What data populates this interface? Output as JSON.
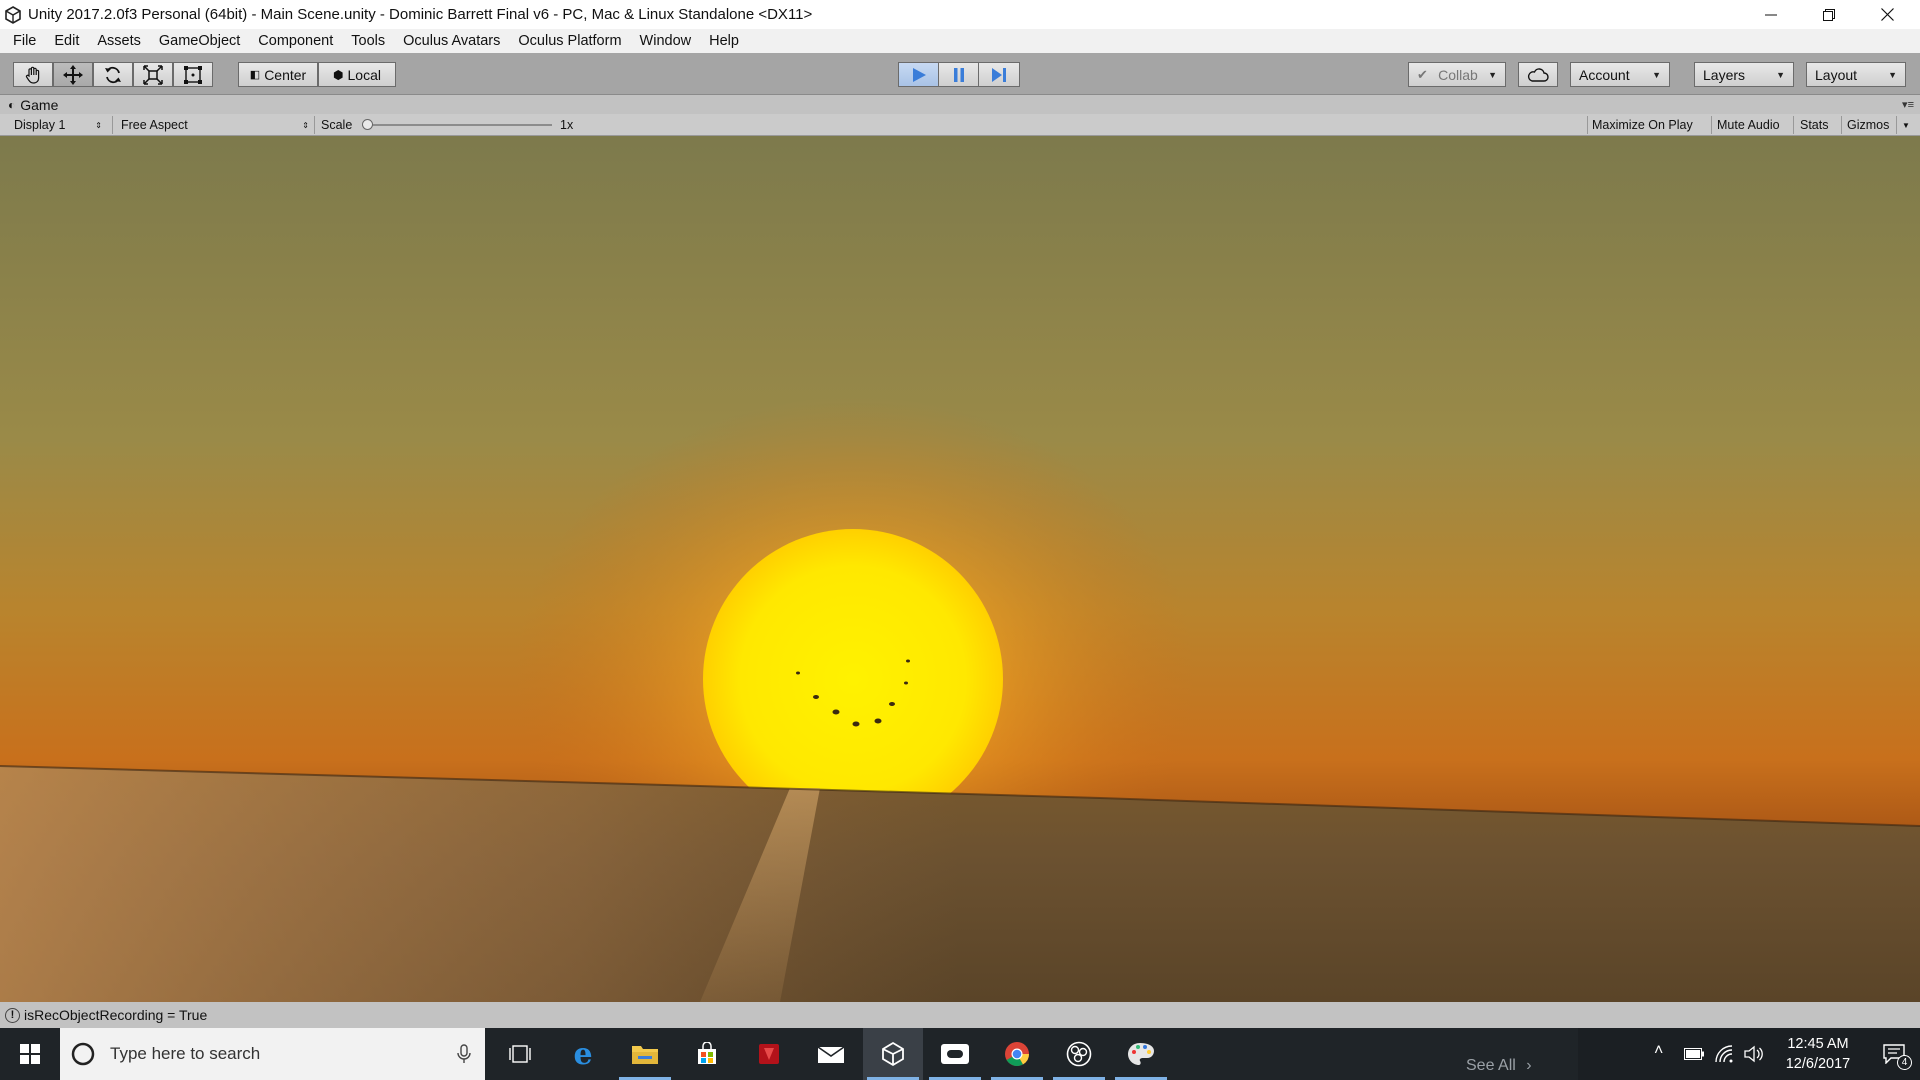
{
  "window": {
    "title": "Unity 2017.2.0f3 Personal (64bit) - Main Scene.unity - Dominic Barrett Final v6 - PC, Mac & Linux Standalone <DX11>"
  },
  "menu": [
    "File",
    "Edit",
    "Assets",
    "GameObject",
    "Component",
    "Tools",
    "Oculus Avatars",
    "Oculus Platform",
    "Window",
    "Help"
  ],
  "toolbar": {
    "tools": [
      "hand-tool",
      "move-tool",
      "rotate-tool",
      "scale-tool",
      "rect-tool"
    ],
    "pivot_label": "Center",
    "space_label": "Local",
    "collab_label": "Collab",
    "account_label": "Account",
    "layers_label": "Layers",
    "layout_label": "Layout"
  },
  "game_tab": {
    "label": "Game",
    "display": "Display 1",
    "aspect": "Free Aspect",
    "scale_label": "Scale",
    "scale_value": "1x",
    "maximize_label": "Maximize On Play",
    "mute_label": "Mute Audio",
    "stats_label": "Stats",
    "gizmos_label": "Gizmos"
  },
  "status": {
    "message": "isRecObjectRecording = True"
  },
  "taskbar": {
    "search_placeholder": "Type here to search",
    "see_all": "See All",
    "time": "12:45 AM",
    "date": "12/6/2017",
    "notifications": "4"
  },
  "colors": {
    "play_active": "#3a7dd9",
    "toolbar_bg": "#a5a5a5",
    "taskbar_bg": "#1f2428"
  }
}
